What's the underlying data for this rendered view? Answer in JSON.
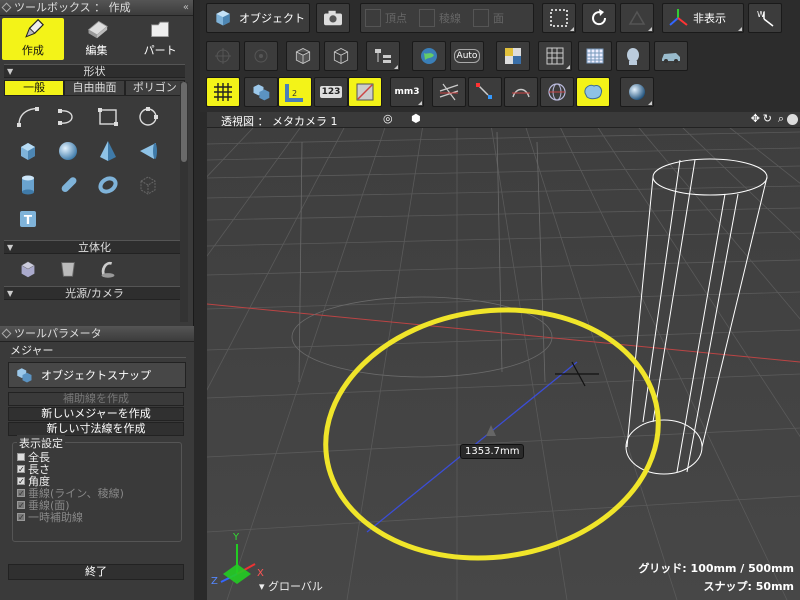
{
  "toolbox": {
    "title": "ツールボックス ： 作成",
    "modes": [
      {
        "label": "作成",
        "active": true
      },
      {
        "label": "編集",
        "active": false
      },
      {
        "label": "パート",
        "active": false
      }
    ],
    "shape_section": "形状",
    "shape_tabs": [
      {
        "label": "一般",
        "active": true
      },
      {
        "label": "自由曲面",
        "active": false
      },
      {
        "label": "ポリゴン",
        "active": false
      }
    ],
    "solid_section": "立体化",
    "light_section": "光源/カメラ"
  },
  "tool_params": {
    "title": "ツールパラメータ",
    "measure_title": "メジャー",
    "object_snap": "オブジェクトスナップ",
    "create_aux": "補助線を作成",
    "new_measure": "新しいメジャーを作成",
    "new_dimension": "新しい寸法線を作成",
    "display_settings": "表示設定",
    "checks": [
      {
        "label": "全長",
        "checked": false,
        "enabled": true
      },
      {
        "label": "長さ",
        "checked": true,
        "enabled": true
      },
      {
        "label": "角度",
        "checked": true,
        "enabled": true
      },
      {
        "label": "垂線(ライン、稜線)",
        "checked": true,
        "enabled": false
      },
      {
        "label": "垂線(面)",
        "checked": true,
        "enabled": false
      },
      {
        "label": "一時補助線",
        "checked": true,
        "enabled": false
      }
    ],
    "end": "終了"
  },
  "toolbar": {
    "object_label": "オブジェクト",
    "vertex_label": "頂点",
    "edge_label": "稜線",
    "face_label": "面",
    "hide_label": "非表示",
    "auto_label": "Auto",
    "mm3_label": "mm3",
    "n123_label": "123"
  },
  "viewport": {
    "title": "透視図 ： メタカメラ 1",
    "measure_value": "1353.7mm",
    "grid_status": "グリッド: 100mm / 500mm",
    "snap_status": "スナップ: 50mm",
    "coordinate": "グローバル",
    "axis_x": "X",
    "axis_y": "Y",
    "axis_z": "Z"
  },
  "colors": {
    "accent": "#f3f318",
    "panel": "#3a3a3a",
    "viewport": "#444444"
  }
}
